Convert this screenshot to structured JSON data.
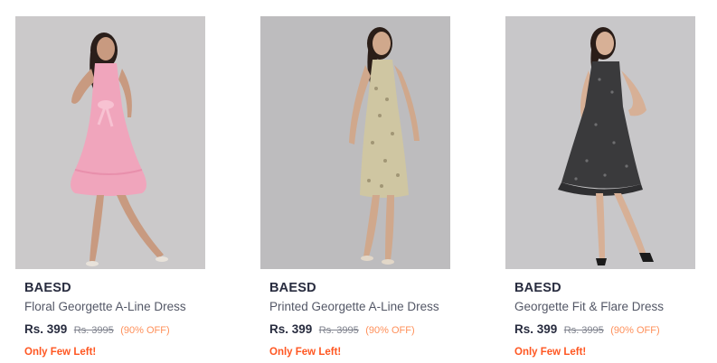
{
  "products": [
    {
      "brand": "BAESD",
      "name": "Floral Georgette A-Line Dress",
      "price": "Rs. 399",
      "mrp": "Rs. 3995",
      "discount": "(90% OFF)",
      "stock_note": "Only Few Left!",
      "dress_color": "#f0a5bc"
    },
    {
      "brand": "BAESD",
      "name": "Printed Georgette A-Line Dress",
      "price": "Rs. 399",
      "mrp": "Rs. 3995",
      "discount": "(90% OFF)",
      "stock_note": "Only Few Left!",
      "dress_color": "#cfc6a2"
    },
    {
      "brand": "BAESD",
      "name": "Georgette Fit & Flare Dress",
      "price": "Rs. 399",
      "mrp": "Rs. 3995",
      "discount": "(90% OFF)",
      "stock_note": "Only Few Left!",
      "dress_color": "#3a3a3c"
    }
  ],
  "colors": {
    "background": "#ffffff",
    "photo_bg": "#c9c7c8",
    "brand_text": "#282c3f",
    "name_text": "#535766",
    "discount": "#ff905a",
    "stock_alert": "#ff5722"
  }
}
